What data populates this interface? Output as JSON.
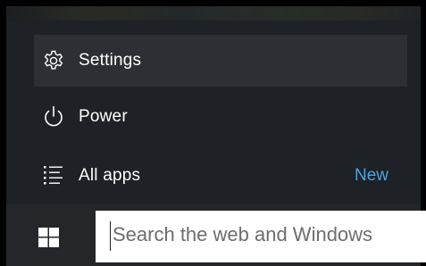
{
  "start_menu": {
    "items": [
      {
        "label": "Settings",
        "icon": "gear-icon"
      },
      {
        "label": "Power",
        "icon": "power-icon"
      },
      {
        "label": "All apps",
        "icon": "all-apps-icon",
        "badge": "New"
      }
    ],
    "highlighted_item": "Settings",
    "background_color": "#1e2125",
    "highlight_color": "#2c2f33",
    "accent_color": "#4aa3e3"
  },
  "taskbar": {
    "start_button_icon": "windows-logo-icon",
    "search": {
      "placeholder": "Search the web and Windows"
    },
    "background_color": "#24262a"
  }
}
